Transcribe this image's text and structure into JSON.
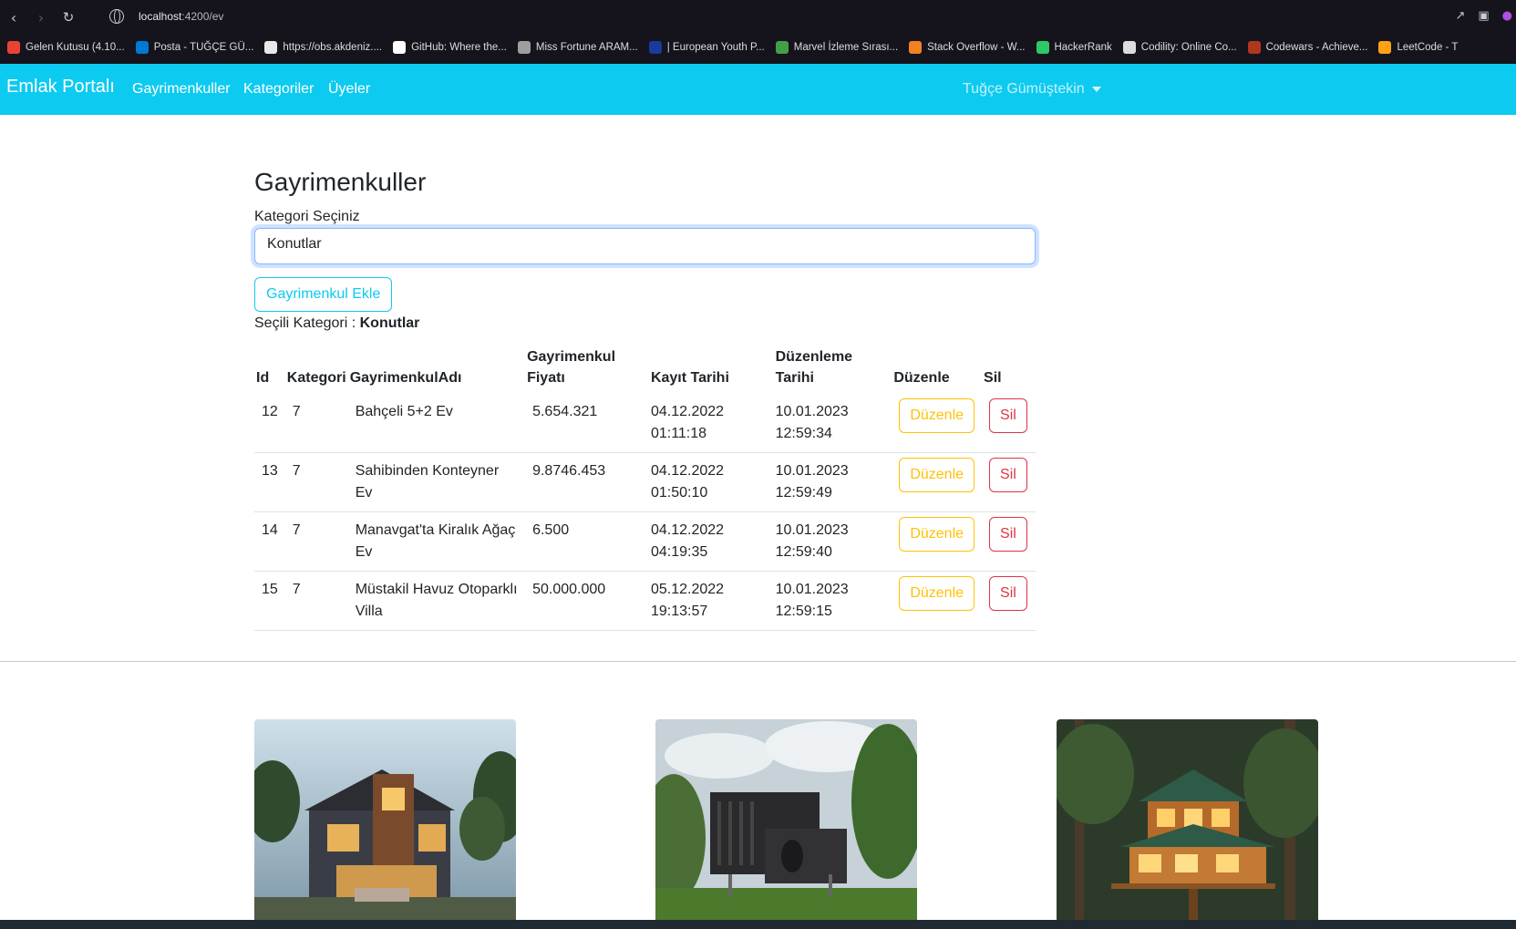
{
  "browser": {
    "url_host": "localhost",
    "url_path": ":4200/ev",
    "bookmarks": [
      {
        "label": "Gelen Kutusu (4.10...",
        "color": "#ea4335"
      },
      {
        "label": "Posta - TUĞÇE GÜ...",
        "color": "#0078d4"
      },
      {
        "label": "https://obs.akdeniz....",
        "color": "#e8e8e8"
      },
      {
        "label": "GitHub: Where the...",
        "color": "#ffffff"
      },
      {
        "label": "Miss Fortune ARAM...",
        "color": "#9e9e9e"
      },
      {
        "label": "| European Youth P...",
        "color": "#1a3a9c"
      },
      {
        "label": "Marvel İzleme Sırası...",
        "color": "#43a047"
      },
      {
        "label": "Stack Overflow - W...",
        "color": "#f48024"
      },
      {
        "label": "HackerRank",
        "color": "#2ec866"
      },
      {
        "label": "Codility: Online Co...",
        "color": "#dddddd"
      },
      {
        "label": "Codewars - Achieve...",
        "color": "#b1361e"
      },
      {
        "label": "LeetCode - T",
        "color": "#ffa116"
      }
    ]
  },
  "navbar": {
    "brand": "Emlak Portalı",
    "links": [
      "Gayrimenkuller",
      "Kategoriler",
      "Üyeler"
    ],
    "user": "Tuğçe Gümüştekin"
  },
  "main": {
    "title": "Gayrimenkuller",
    "select_label": "Kategori Seçiniz",
    "select_value": "Konutlar",
    "add_button": "Gayrimenkul Ekle",
    "selected_prefix": "Seçili Kategori :",
    "selected_value": "Konutlar"
  },
  "table": {
    "headers": [
      "Id",
      "Kategori",
      "GayrimenkulAdı",
      "Gayrimenkul Fiyatı",
      "Kayıt Tarihi",
      "Düzenleme Tarihi",
      "Düzenle",
      "Sil"
    ],
    "rows": [
      {
        "id": "12",
        "kategori": "7",
        "ad": "Bahçeli 5+2 Ev",
        "fiyat": "5.654.321",
        "kayit": "04.12.2022 01:11:18",
        "duzenleme": "10.01.2023 12:59:34"
      },
      {
        "id": "13",
        "kategori": "7",
        "ad": "Sahibinden Konteyner Ev",
        "fiyat": "9.8746.453",
        "kayit": "04.12.2022 01:50:10",
        "duzenleme": "10.01.2023 12:59:49"
      },
      {
        "id": "14",
        "kategori": "7",
        "ad": "Manavgat'ta Kiralık Ağaç Ev",
        "fiyat": "6.500",
        "kayit": "04.12.2022 04:19:35",
        "duzenleme": "10.01.2023 12:59:40"
      },
      {
        "id": "15",
        "kategori": "7",
        "ad": "Müstakil Havuz Otoparklı Villa",
        "fiyat": "50.000.000",
        "kayit": "05.12.2022 19:13:57",
        "duzenleme": "10.01.2023 12:59:15"
      }
    ],
    "edit_label": "Düzenle",
    "delete_label": "Sil"
  },
  "colors": {
    "navbar": "#0dcaf0",
    "edit": "#ffc107",
    "delete": "#dc3545",
    "info": "#0dcaf0"
  }
}
